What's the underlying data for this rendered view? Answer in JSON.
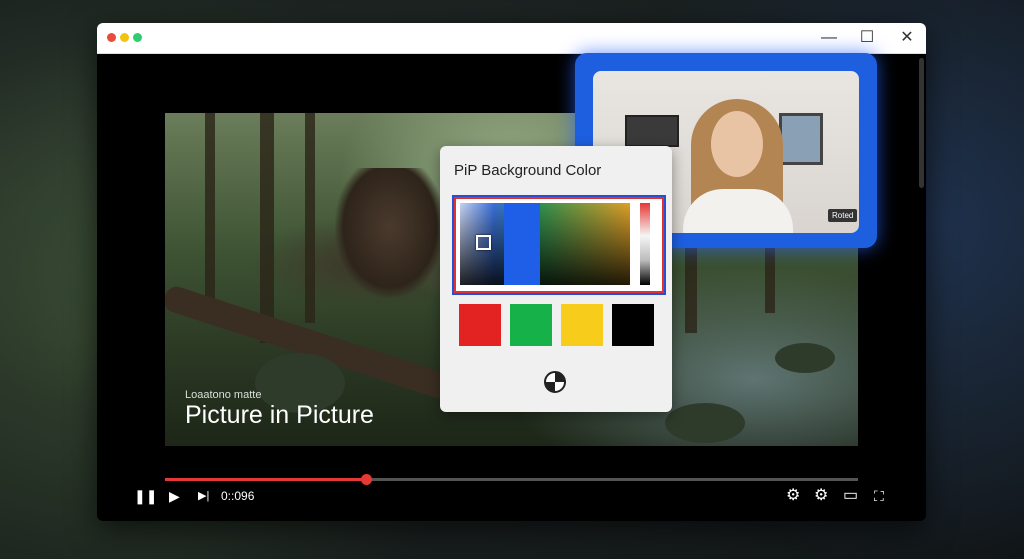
{
  "window": {
    "controls": {
      "minimize": "—",
      "maximize": "☐",
      "close": "✕"
    }
  },
  "video": {
    "subtitle": "Loaatono matte",
    "title": "Picture in Picture",
    "progress_fraction": 0.29,
    "time": "0::096"
  },
  "controls": {
    "pause": "❚❚",
    "play": "▶",
    "next": "▶|",
    "settings": "⚙",
    "settings_alt": "⚙",
    "captions": "▭",
    "fullscreen": "⛶"
  },
  "pip": {
    "badge": "Roted",
    "border_color": "#1e5fe0"
  },
  "picker": {
    "title": "PiP Background Color",
    "selected_color": "#1f5ee6",
    "swatches": [
      {
        "name": "red",
        "color": "#e32222"
      },
      {
        "name": "green",
        "color": "#16b249"
      },
      {
        "name": "yellow",
        "color": "#f7cc1b"
      },
      {
        "name": "black",
        "color": "#000000"
      }
    ]
  },
  "colors": {
    "accent_red": "#e53935"
  }
}
